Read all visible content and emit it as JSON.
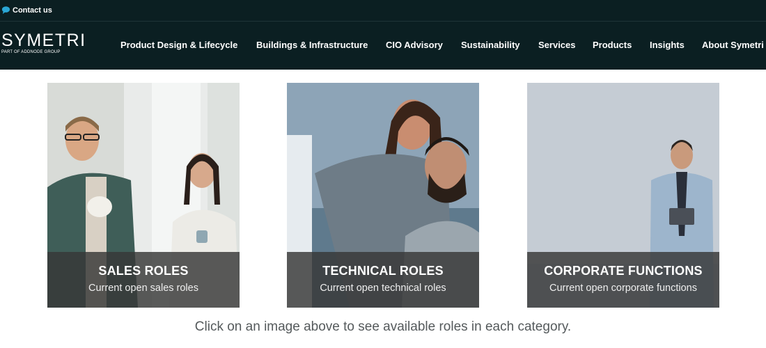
{
  "topbar": {
    "contact_label": "Contact us",
    "contact_icon": "chat-bubble-icon"
  },
  "header": {
    "logo_word": "SYMETRI",
    "logo_sub": "PART OF ADDNODE GROUP",
    "nav": [
      {
        "label": "Product Design & Lifecycle"
      },
      {
        "label": "Buildings & Infrastructure"
      },
      {
        "label": "CIO Advisory"
      },
      {
        "label": "Sustainability"
      },
      {
        "label": "Services"
      },
      {
        "label": "Products"
      },
      {
        "label": "Insights"
      },
      {
        "label": "About Symetri"
      }
    ]
  },
  "cards": [
    {
      "title": "SALES ROLES",
      "subtitle": "Current open sales roles"
    },
    {
      "title": "TECHNICAL ROLES",
      "subtitle": "Current open technical roles"
    },
    {
      "title": "CORPORATE FUNCTIONS",
      "subtitle": "Current open corporate functions"
    }
  ],
  "hint": "Click on an image above to see available roles in each category.",
  "colors": {
    "header_bg": "#0b1f22",
    "overlay_bg": "#373737",
    "accent_icon": "#2aa7d6"
  }
}
